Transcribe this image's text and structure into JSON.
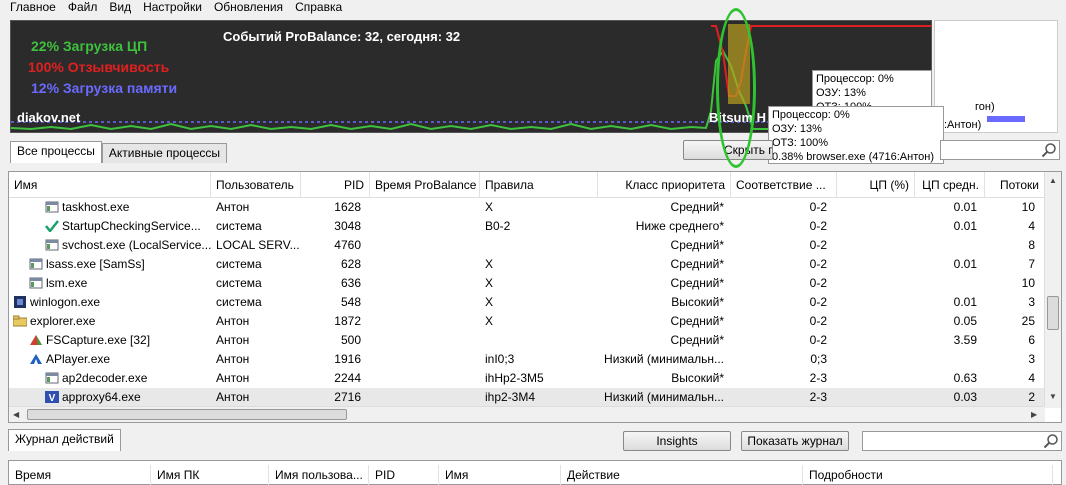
{
  "menu": [
    "Главное",
    "Файл",
    "Вид",
    "Настройки",
    "Обновления",
    "Справка"
  ],
  "graph": {
    "cpu_label": "22% Загрузка ЦП",
    "resp_label": "100% Отзывчивость",
    "mem_label": "12% Загрузка памяти",
    "events": "Событий ProBalance: 32, сегодня: 32",
    "site": "diakov.net",
    "bitsum": "Bitsum H",
    "colors": {
      "cpu": "#3ec23e",
      "resp": "#e02020",
      "mem": "#6a6aff",
      "bg": "#2b2b2b"
    }
  },
  "tooltip1": [
    "Процессор: 0%",
    "ОЗУ: 13%",
    "ОТЗ: 100%"
  ],
  "tooltip2": [
    "Процессор: 0%",
    "ОЗУ: 13%",
    "ОТЗ: 100%",
    "0.38% browser.exe (4716:Антон)"
  ],
  "tooltip_side": ":Антон)",
  "legend_text": "гон)",
  "tabs": {
    "all": "Все процессы",
    "active": "Активные процессы"
  },
  "hide_button": "Скрыть п",
  "columns": [
    "Имя",
    "Пользователь",
    "PID",
    "Время ProBalance",
    "Правила",
    "Класс приоритета",
    "Соответствие ...",
    "ЦП (%)",
    "ЦП средн.",
    "Потоки"
  ],
  "processes": [
    {
      "name": "taskhost.exe",
      "user": "Антон",
      "pid": "1628",
      "pb": "",
      "rules": "X",
      "prio": "Средний*",
      "aff": "0-2",
      "cpu": "",
      "cpuavg": "0.01",
      "threads": "10",
      "icon": "window-icon",
      "indent": 2
    },
    {
      "name": "StartupCheckingService...",
      "user": "система",
      "pid": "3048",
      "pb": "",
      "rules": "B0-2",
      "prio": "Ниже среднего*",
      "aff": "0-2",
      "cpu": "",
      "cpuavg": "0.01",
      "threads": "4",
      "icon": "checkmark-icon",
      "indent": 2
    },
    {
      "name": "svchost.exe (LocalService...",
      "user": "LOCAL SERV...",
      "pid": "4760",
      "pb": "",
      "rules": "",
      "prio": "Средний*",
      "aff": "0-2",
      "cpu": "",
      "cpuavg": "",
      "threads": "8",
      "icon": "window-icon",
      "indent": 2
    },
    {
      "name": "lsass.exe [SamSs]",
      "user": "система",
      "pid": "628",
      "pb": "",
      "rules": "X",
      "prio": "Средний*",
      "aff": "0-2",
      "cpu": "",
      "cpuavg": "0.01",
      "threads": "7",
      "icon": "window-icon",
      "indent": 1
    },
    {
      "name": "lsm.exe",
      "user": "система",
      "pid": "636",
      "pb": "",
      "rules": "X",
      "prio": "Средний*",
      "aff": "0-2",
      "cpu": "",
      "cpuavg": "",
      "threads": "10",
      "icon": "window-icon",
      "indent": 1
    },
    {
      "name": "winlogon.exe",
      "user": "система",
      "pid": "548",
      "pb": "",
      "rules": "X",
      "prio": "Высокий*",
      "aff": "0-2",
      "cpu": "",
      "cpuavg": "0.01",
      "threads": "3",
      "icon": "winlogon-icon",
      "indent": 0
    },
    {
      "name": "explorer.exe",
      "user": "Антон",
      "pid": "1872",
      "pb": "",
      "rules": "X",
      "prio": "Средний*",
      "aff": "0-2",
      "cpu": "",
      "cpuavg": "0.05",
      "threads": "25",
      "icon": "folder-icon",
      "indent": 0
    },
    {
      "name": "FSCapture.exe [32]",
      "user": "Антон",
      "pid": "500",
      "pb": "",
      "rules": "",
      "prio": "Средний*",
      "aff": "0-2",
      "cpu": "",
      "cpuavg": "3.59",
      "threads": "6",
      "icon": "capture-icon",
      "indent": 1
    },
    {
      "name": "APlayer.exe",
      "user": "Антон",
      "pid": "1916",
      "pb": "",
      "rules": "inI0;3",
      "prio": "Низкий (минимальн...",
      "aff": "0;3",
      "cpu": "",
      "cpuavg": "",
      "threads": "3",
      "icon": "player-icon",
      "indent": 1
    },
    {
      "name": "ap2decoder.exe",
      "user": "Антон",
      "pid": "2244",
      "pb": "",
      "rules": "ihHp2-3M5",
      "prio": "Высокий*",
      "aff": "2-3",
      "cpu": "",
      "cpuavg": "0.63",
      "threads": "4",
      "icon": "window-icon",
      "indent": 2
    },
    {
      "name": "approxy64.exe",
      "user": "Антон",
      "pid": "2716",
      "pb": "",
      "rules": "ihp2-3M4",
      "prio": "Низкий (минимальн...",
      "aff": "2-3",
      "cpu": "",
      "cpuavg": "0.03",
      "threads": "2",
      "icon": "v-app-icon",
      "indent": 2
    }
  ],
  "log": {
    "tab": "Журнал действий",
    "insights": "Insights",
    "show_log": "Показать журнал",
    "columns": [
      "Время",
      "Имя ПК",
      "Имя пользова...",
      "PID",
      "Имя",
      "Действие",
      "Подробности"
    ]
  }
}
